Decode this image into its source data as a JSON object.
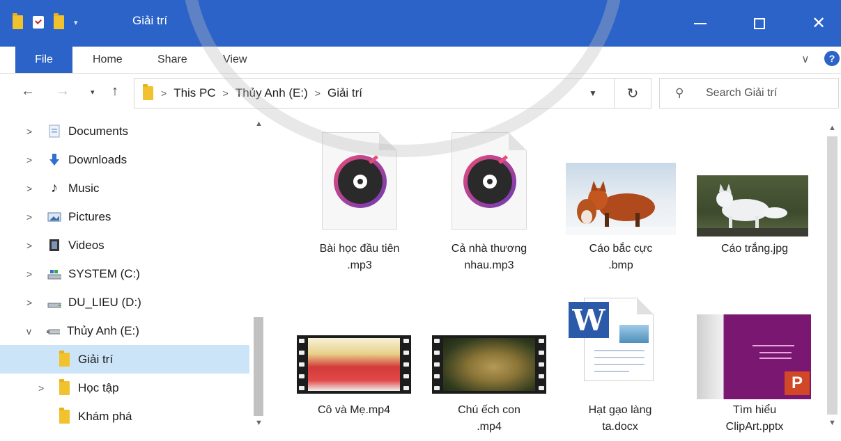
{
  "window": {
    "title": "Giải trí",
    "accent": "#2b63c8",
    "controls": {
      "minimize": "—",
      "maximize": "□",
      "close": "✕"
    }
  },
  "ribbon": {
    "file_tab": "File",
    "tabs": [
      "Home",
      "Share",
      "View"
    ],
    "expand_icon": "chevron-down-icon",
    "help": "?"
  },
  "address": {
    "path": [
      "This PC",
      "Thủy Anh (E:)",
      "Giải trí"
    ],
    "separator": ">",
    "search_placeholder": "Search Giải trí"
  },
  "sidebar": {
    "items": [
      {
        "label": "Documents",
        "icon": "documents-icon",
        "expander": ">"
      },
      {
        "label": "Downloads",
        "icon": "downloads-icon",
        "expander": ">"
      },
      {
        "label": "Music",
        "icon": "music-icon",
        "expander": ">"
      },
      {
        "label": "Pictures",
        "icon": "pictures-icon",
        "expander": ">"
      },
      {
        "label": "Videos",
        "icon": "videos-icon",
        "expander": ">"
      },
      {
        "label": "SYSTEM (C:)",
        "icon": "drive-icon",
        "expander": ">"
      },
      {
        "label": "DU_LIEU (D:)",
        "icon": "drive-icon",
        "expander": ">"
      },
      {
        "label": "Thủy Anh (E:)",
        "icon": "usb-drive-icon",
        "expander": "v"
      },
      {
        "label": "Giải trí",
        "icon": "folder-icon",
        "expander": "",
        "selected": true
      },
      {
        "label": "Học tập",
        "icon": "folder-icon",
        "expander": ">"
      },
      {
        "label": "Khám phá",
        "icon": "folder-icon",
        "expander": ""
      }
    ]
  },
  "files": [
    {
      "name": "Bài học đầu tiên\n.mp3",
      "type": "audio"
    },
    {
      "name": "Cả nhà thương\nnhau.mp3",
      "type": "audio"
    },
    {
      "name": "Cáo bắc cực\n.bmp",
      "type": "image"
    },
    {
      "name": "Cáo trắng.jpg",
      "type": "image"
    },
    {
      "name": "Cô và Mẹ.mp4",
      "type": "video"
    },
    {
      "name": "Chú ếch con\n.mp4",
      "type": "video"
    },
    {
      "name": "Hạt gạo làng\nta.docx",
      "type": "word"
    },
    {
      "name": "Tìm hiểu\nClipArt.pptx",
      "type": "powerpoint"
    }
  ]
}
